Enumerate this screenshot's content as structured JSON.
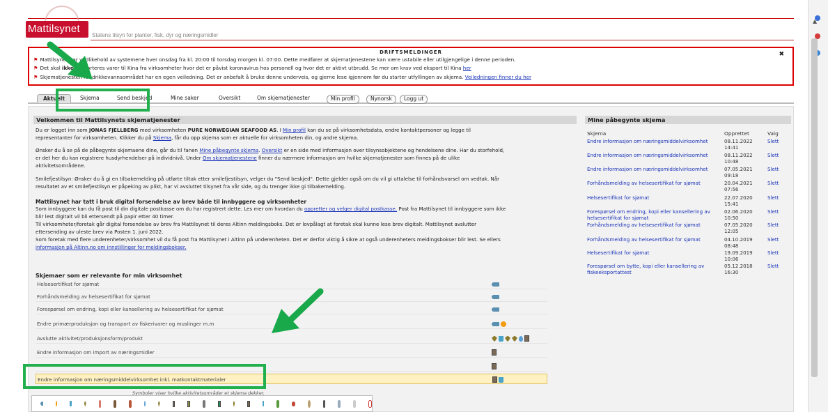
{
  "header": {
    "logo": "Mattilsynet",
    "tagline": "Statens tilsyn for planter, fisk, dyr og næringsmidler"
  },
  "drift": {
    "title": "DRIFTSMELDINGER",
    "close": "✖",
    "line1": "Mattilsynet har vedlikehold av systemene hver onsdag fra kl. 20:00 til torsdag morgen kl. 07:00. Dette medfører at skjematjenestene kan være ustabile eller utilgjengelige i denne perioden.",
    "line2_pre": "Det skal ",
    "line2_bold": "ikke",
    "line2_post": " eksporteres varer til Kina fra virksomheter hvor det er påvist koronavirus hos personell og hvor det er aktivt utbrudd. Se mer om krav ved eksport til Kina ",
    "line2_link": "her",
    "line3_pre": "Skjematjenesten for drikkevannsområdet har en egen veiledning. Det er anbefalt å bruke denne underveis, og gjerne lese igjennom før du starter utfyllingen av skjema. ",
    "line3_link": "Veiledningen finner du her"
  },
  "tabs": {
    "aktuelt": "Aktuelt",
    "skjema": "Skjema",
    "send_beskjed": "Send beskjed",
    "mine_saker": "Mine saker",
    "oversikt": "Oversikt",
    "om": "Om skjematjenester",
    "min_profil": "Min profil",
    "nynorsk": "Nynorsk",
    "logg_ut": "Logg ut"
  },
  "welcome": {
    "title": "Velkommen til Mattilsynets skjematjenester",
    "p1a": "Du er logget inn som ",
    "p1_user": "JONAS FJELLBERG",
    "p1b": " med virksomheten ",
    "p1_company": "PURE NORWEGIAN SEAFOOD AS",
    "p1c": ". I ",
    "p1_link": "Min profil",
    "p1d": " kan du se på virksomhetsdata, endre kontaktpersoner og legge til",
    "p1e": "representanter for virksomheten. Klikker du på ",
    "p1_link2": "Skjema",
    "p1f": ", får du opp skjema som er aktuelle for virksomheten din, og andre skjema.",
    "p2a": "Ønsker du å se på de påbegynte skjemaene dine, går du til fanen ",
    "p2_link": "Mine påbegynte skjema",
    "p2b": ". ",
    "p2_link2": "Oversikt",
    "p2c": " er en side med informasjon over tilsynsobjektene og hendelsene dine. Har du storfehold,",
    "p2d": "er det her du kan registrere husdyrhendelser på individnivå. Under ",
    "p2_link3": "Om skjematjenestene",
    "p2e": " finner du nærmere informasjon om hvilke skjematjenester som finnes på de ulike",
    "p2f": "aktivitetsområdene.",
    "p3a": "Smilefjestilsyn: Ønsker du å gi en tilbakemelding på utførte tiltak etter smilefjestilsyn, velger du \"Send beskjed\". Dette gjelder også om du vil gi uttalelse til forhåndsvarsel om vedtak. Når",
    "p3b": "resultatet av et smilefjestilsyn er påpeking av plikt, har vi avsluttet tilsynet fra vår side, og du trenger ikke gi tilbakemelding.",
    "h2": "Mattilsynet har tatt i bruk digital forsendelse av brev både til innbyggere og virksomheter",
    "p4a": "Som innbyggere kan du få post til din digitale postkasse om du har registrert dette. Les mer om hvordan du ",
    "p4_link": "oppretter og velger digital postkasse.",
    "p4b": " Post fra Mattilsynet til innbyggere som ikke",
    "p4c": "blir lest digitalt vil bli ettersendt på papir etter 40 timer.",
    "p4d": "Til virksomheter/foretak går digital forsendelse av brev fra Mattilsynet til deres Altinn meldingsboks. Det er lovpålagt at foretak skal kunne lese brev digitalt. Mattilsynet avslutter",
    "p4e": "ettersending av uleste brev via Posten 1. juni 2022.",
    "p4f": "Som foretak med flere underenheter/virksomhet vil du få post fra Mattilsynet i Altinn på underenheten. Det er derfor viktig å sikre at også underenheters meldingsbokser blir lest. Se ellers",
    "p4_link2": "informasjon på Altinn.no om innstillinger for meldingsbokser."
  },
  "skjema_section": {
    "title": "Skjemaer som er relevante for min virksomhet",
    "rows": [
      "Helsesertifikat for sjømat",
      "Forhåndsmelding av helsesertifikat for sjømat",
      "Forespørsel om endring, kopi eller kansellering av helsesertifikat for sjømat",
      "Endre primærproduksjon og transport av fiskerivarer og muslinger m.m",
      "Avslutte aktivitet/produksjonsform/produkt",
      "Endre informasjon om import av næringsmidler",
      "Endre informasjon om næringsmiddelvirksomhet inkl. matkontaktmaterialer"
    ],
    "legend_caption": "Symboler viser hvilke aktivitetsområder et skjema dekker."
  },
  "pabegynte": {
    "title": "Mine påbegynte skjema",
    "col_skjema": "Skjema",
    "col_opprettet": "Opprettet",
    "col_valg": "Valg",
    "rows": [
      {
        "name": "Endre informasjon om næringsmiddelvirksomhet",
        "date": "08.11.2022",
        "time": "14:41",
        "action": "Slett"
      },
      {
        "name": "Endre informasjon om næringsmiddelvirksomhet",
        "date": "08.11.2022",
        "time": "10:48",
        "action": "Slett"
      },
      {
        "name": "Endre informasjon om næringsmiddelvirksomhet",
        "date": "07.05.2021",
        "time": "09:18",
        "action": "Slett"
      },
      {
        "name": "Forhåndsmelding av helsesertifikat for sjømat",
        "date": "20.04.2021",
        "time": "07:56",
        "action": "Slett"
      },
      {
        "name": "Helsesertifikat for sjømat",
        "date": "22.07.2020",
        "time": "15:41",
        "action": "Slett"
      },
      {
        "name": "Forespørsel om endring, kopi eller kansellering av helsesertifikat for sjømat",
        "date": "02.06.2020",
        "time": "10:50",
        "action": "Slett"
      },
      {
        "name": "Forhåndsmelding av helsesertifikat for sjømat",
        "date": "07.05.2020",
        "time": "12:05",
        "action": "Slett"
      },
      {
        "name": "Forhåndsmelding av helsesertifikat for sjømat",
        "date": "04.10.2019",
        "time": "08:48",
        "action": "Slett"
      },
      {
        "name": "Helsesertifikat for sjømat",
        "date": "19.09.2019",
        "time": "10:06",
        "action": "Slett"
      },
      {
        "name": "Forespørsel om bytte, kopi eller kansellering av fiskeeksportattest",
        "date": "05.12.2018",
        "time": "16:30",
        "action": "Slett"
      }
    ]
  },
  "colors": {
    "brand": "#c8102e",
    "link": "#1a33b8",
    "highlight": "#22b04f"
  }
}
